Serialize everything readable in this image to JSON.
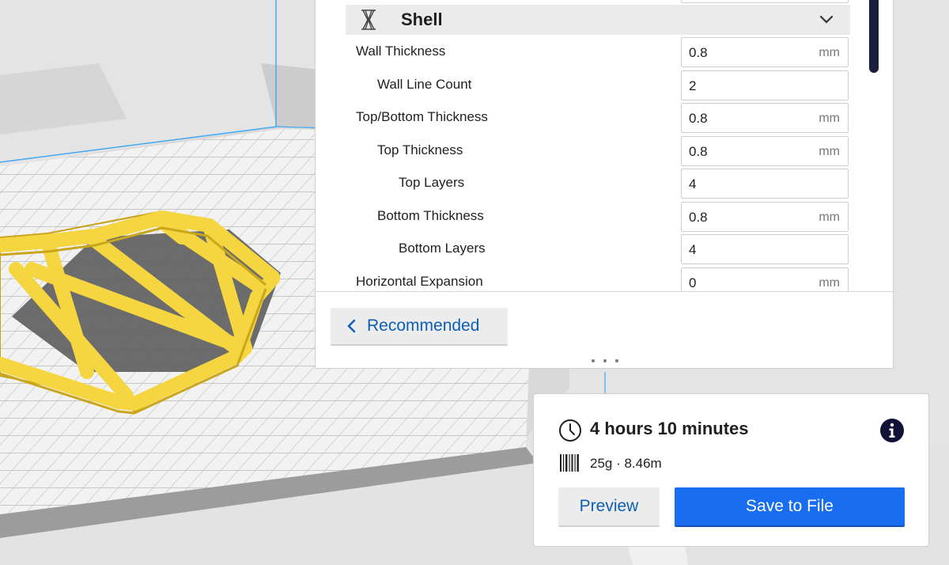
{
  "section": {
    "title": "Shell",
    "icon": "shell-icon",
    "expand_icon": "chevron-down-icon"
  },
  "settings": [
    {
      "label": "Wall Thickness",
      "value": "0.8",
      "unit": "mm",
      "indent": 0
    },
    {
      "label": "Wall Line Count",
      "value": "2",
      "unit": "",
      "indent": 1
    },
    {
      "label": "Top/Bottom Thickness",
      "value": "0.8",
      "unit": "mm",
      "indent": 0
    },
    {
      "label": "Top Thickness",
      "value": "0.8",
      "unit": "mm",
      "indent": 1
    },
    {
      "label": "Top Layers",
      "value": "4",
      "unit": "",
      "indent": 2
    },
    {
      "label": "Bottom Thickness",
      "value": "0.8",
      "unit": "mm",
      "indent": 1
    },
    {
      "label": "Bottom Layers",
      "value": "4",
      "unit": "",
      "indent": 2
    },
    {
      "label": "Horizontal Expansion",
      "value": "0",
      "unit": "mm",
      "indent": 0
    }
  ],
  "recommended_button": {
    "label": "Recommended",
    "icon": "chevron-left-icon"
  },
  "print_info": {
    "time": "4 hours 10 minutes",
    "time_icon": "clock-icon",
    "material": "25g · 8.46m",
    "material_icon": "filament-spool-icon",
    "info_icon": "info-icon"
  },
  "actions": {
    "preview_label": "Preview",
    "save_label": "Save to File"
  },
  "colors": {
    "accent": "#196ef0",
    "link_text": "#0c5fb5",
    "model_yellow": "#f5d540",
    "scrollbar": "#1c1c3f",
    "build_volume_line": "#40a9f0"
  }
}
